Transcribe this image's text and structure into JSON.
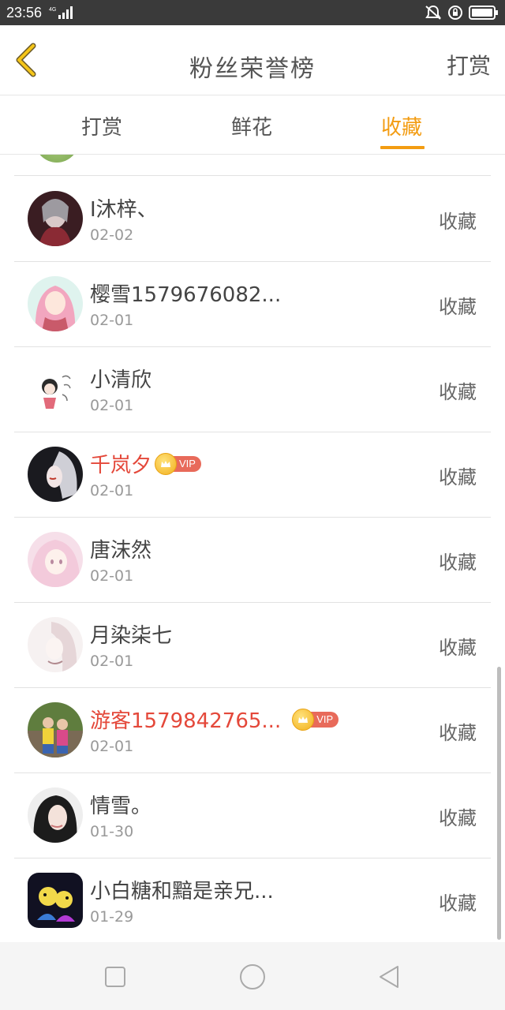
{
  "status_bar": {
    "time": "23:56",
    "network": "4G"
  },
  "header": {
    "back_icon": "chevron-left-icon",
    "title": "粉丝荣誉榜",
    "action": "打赏"
  },
  "tabs": [
    {
      "label": "打赏",
      "active": false
    },
    {
      "label": "鲜花",
      "active": false
    },
    {
      "label": "收藏",
      "active": true
    }
  ],
  "colors": {
    "accent": "#f39c12",
    "vip_name": "#e4483a",
    "status_bar": "#3a3a3a"
  },
  "list": [
    {
      "name": "I沐梓、",
      "date": "02-02",
      "action": "收藏",
      "vip": false
    },
    {
      "name": "樱雪1579676082...",
      "date": "02-01",
      "action": "收藏",
      "vip": false
    },
    {
      "name": "小清欣",
      "date": "02-01",
      "action": "收藏",
      "vip": false
    },
    {
      "name": "千岚夕",
      "date": "02-01",
      "action": "收藏",
      "vip": true,
      "badge": "VIP"
    },
    {
      "name": "唐沫然",
      "date": "02-01",
      "action": "收藏",
      "vip": false
    },
    {
      "name": "月染柒七",
      "date": "02-01",
      "action": "收藏",
      "vip": false
    },
    {
      "name": "游客1579842765...",
      "date": "02-01",
      "action": "收藏",
      "vip": true,
      "badge": "VIP"
    },
    {
      "name": "情雪。",
      "date": "01-30",
      "action": "收藏",
      "vip": false
    },
    {
      "name": "小白糖和黯是亲兄...",
      "date": "01-29",
      "action": "收藏",
      "vip": false
    }
  ]
}
